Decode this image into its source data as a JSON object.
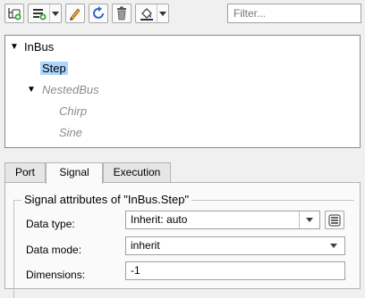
{
  "toolbar": {
    "buttons": [
      {
        "name": "add-bus-element",
        "icon": "add-element-icon",
        "has_dropdown": false
      },
      {
        "name": "insert-element",
        "icon": "insert-list-icon",
        "has_dropdown": true
      },
      {
        "name": "edit",
        "icon": "pencil-icon",
        "has_dropdown": false
      },
      {
        "name": "refresh",
        "icon": "refresh-icon",
        "has_dropdown": false
      },
      {
        "name": "delete",
        "icon": "trash-icon",
        "has_dropdown": false
      },
      {
        "name": "highlight",
        "icon": "paint-bucket-icon",
        "has_dropdown": true
      }
    ],
    "filter_placeholder": "Filter..."
  },
  "tree": {
    "root": "InBus",
    "items": [
      {
        "label": "Step",
        "selected": true
      },
      {
        "label": "NestedBus",
        "expanded": true,
        "children": [
          "Chirp",
          "Sine"
        ]
      }
    ]
  },
  "tabs": [
    "Port",
    "Signal",
    "Execution"
  ],
  "active_tab": "Signal",
  "signal_attributes": {
    "title": "Signal attributes of \"InBus.Step\"",
    "data_type_label": "Data type:",
    "data_type_value": "Inherit: auto",
    "data_mode_label": "Data mode:",
    "data_mode_value": "inherit",
    "dimensions_label": "Dimensions:",
    "dimensions_value": "-1"
  },
  "colors": {
    "selection": "#add6ff",
    "muted_text": "#8c8c8c",
    "accent_orange": "#e8a23a",
    "accent_blue": "#2f66c2"
  }
}
